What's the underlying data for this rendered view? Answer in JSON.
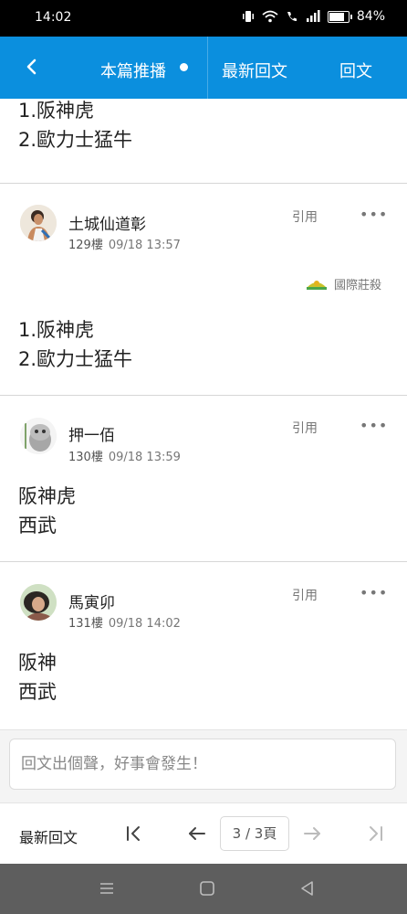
{
  "status_bar": {
    "time": "14:02",
    "battery": "84%"
  },
  "navbar": {
    "tabs": [
      {
        "label": "本篇推播"
      },
      {
        "label": "最新回文"
      },
      {
        "label": "回文"
      }
    ]
  },
  "partial_post": {
    "lines": [
      "1.阪神虎",
      "2.歐力士猛牛"
    ]
  },
  "posts": [
    {
      "username": "土城仙道彰",
      "floor": "129樓",
      "date": "09/18 13:57",
      "quote_label": "引用",
      "more_label": "•••",
      "signature": "國際莊殺",
      "lines": [
        "1.阪神虎",
        "2.歐力士猛牛"
      ]
    },
    {
      "username": "押一佰",
      "floor": "130樓",
      "date": "09/18 13:59",
      "quote_label": "引用",
      "more_label": "•••",
      "lines": [
        "阪神虎",
        "西武"
      ]
    },
    {
      "username": "馬寅卯",
      "floor": "131樓",
      "date": "09/18 14:02",
      "quote_label": "引用",
      "more_label": "•••",
      "lines": [
        "阪神",
        "西武"
      ]
    }
  ],
  "reply": {
    "placeholder": "回文出個聲，好事會發生！"
  },
  "pager": {
    "latest_label": "最新回文",
    "page_indicator": "3 / 3頁"
  },
  "colors": {
    "nav_blue": "#0b8fde",
    "status_black": "#000000",
    "system_nav": "#5e5e5e"
  }
}
